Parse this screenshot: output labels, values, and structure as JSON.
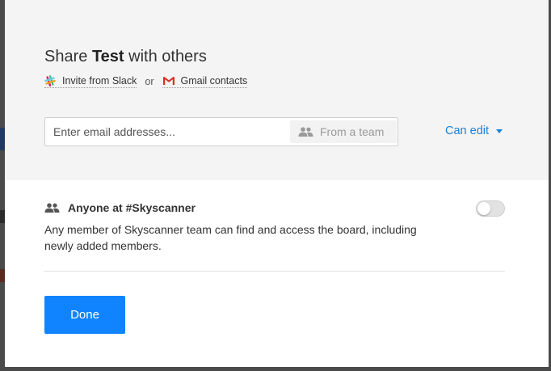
{
  "dialog": {
    "title_prefix": "Share ",
    "board_name": "Test",
    "title_suffix": " with others"
  },
  "invite": {
    "slack_label": "Invite from Slack",
    "or_text": "or",
    "gmail_label": "Gmail contacts"
  },
  "email": {
    "placeholder": "Enter email addresses...",
    "value": "",
    "from_team_label": "From a team"
  },
  "permission": {
    "selected": "Can edit"
  },
  "team_access": {
    "label": "Anyone at #Skyscanner",
    "description": "Any member of Skyscanner team can find and access the board, including newly added members.",
    "enabled": false
  },
  "actions": {
    "done_label": "Done"
  },
  "colors": {
    "accent": "#1a7fd8",
    "primary_button": "#1084ff",
    "gmail_red": "#d93025"
  }
}
